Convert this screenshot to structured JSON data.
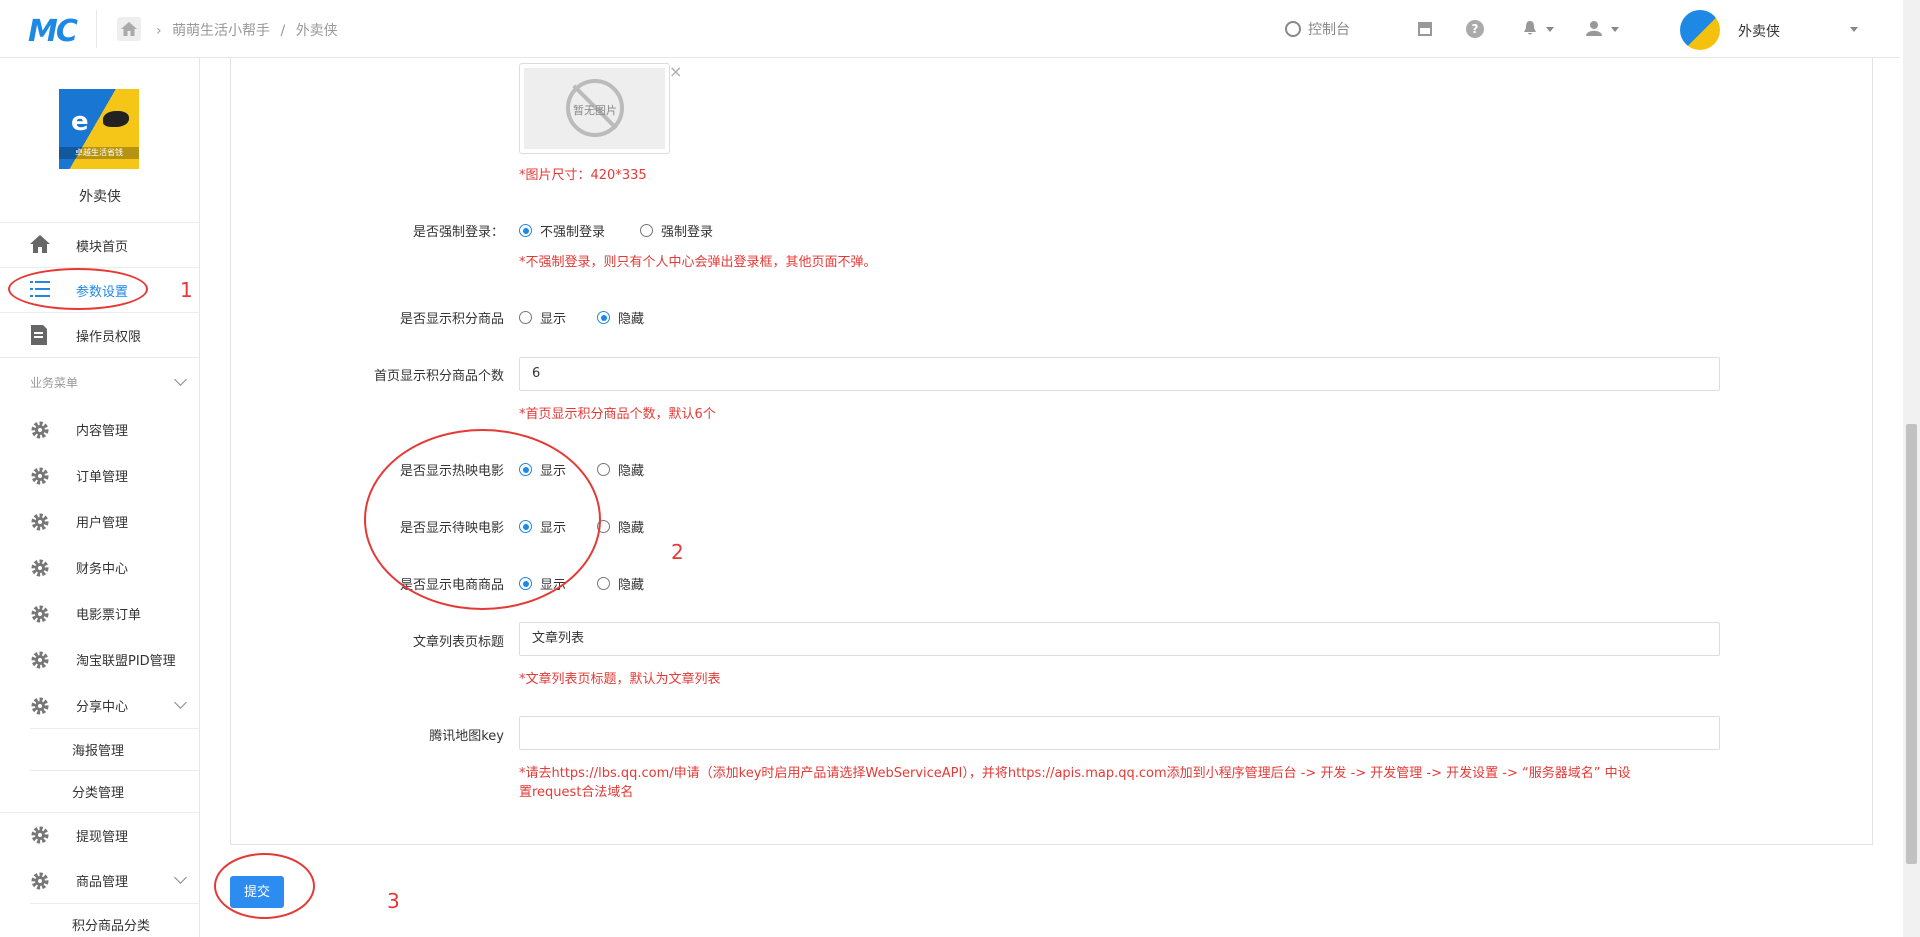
{
  "header": {
    "logo_text": "MC",
    "breadcrumb": [
      "萌萌生活小帮手",
      "外卖侠"
    ],
    "console_label": "控制台",
    "user_name": "外卖侠"
  },
  "sidebar": {
    "shop_name": "外卖侠",
    "shop_logo_caption": "卓越生活省钱",
    "top_items": [
      {
        "label": "模块首页",
        "icon": "home-icon"
      },
      {
        "label": "参数设置",
        "icon": "list-icon",
        "active": true
      },
      {
        "label": "操作员权限",
        "icon": "document-icon"
      }
    ],
    "section_title": "业务菜单",
    "items": [
      {
        "label": "内容管理",
        "icon": "gear-icon"
      },
      {
        "label": "订单管理",
        "icon": "gear-icon"
      },
      {
        "label": "用户管理",
        "icon": "gear-icon"
      },
      {
        "label": "财务中心",
        "icon": "gear-icon"
      },
      {
        "label": "电影票订单",
        "icon": "gear-icon"
      },
      {
        "label": "淘宝联盟PID管理",
        "icon": "gear-icon"
      },
      {
        "label": "分享中心",
        "icon": "gear-icon",
        "expanded": true
      },
      {
        "label": "提现管理",
        "icon": "gear-icon"
      },
      {
        "label": "商品管理",
        "icon": "gear-icon",
        "expanded": true
      }
    ],
    "share_sub": [
      "海报管理",
      "分类管理"
    ],
    "goods_sub": [
      "积分商品分类"
    ]
  },
  "form": {
    "image_placeholder": "暂无图片",
    "image_close": "×",
    "image_hint": "*图片尺寸：420*335",
    "force_login": {
      "label": "是否强制登录：",
      "options": [
        "不强制登录",
        "强制登录"
      ],
      "selected": 0,
      "hint": "*不强制登录，则只有个人中心会弹出登录框，其他页面不弹。"
    },
    "show_points_goods": {
      "label": "是否显示积分商品",
      "options": [
        "显示",
        "隐藏"
      ],
      "selected": 1
    },
    "points_count": {
      "label": "首页显示积分商品个数",
      "value": "6",
      "hint": "*首页显示积分商品个数，默认6个"
    },
    "show_hot_movies": {
      "label": "是否显示热映电影",
      "options": [
        "显示",
        "隐藏"
      ],
      "selected": 0
    },
    "show_upcoming_movies": {
      "label": "是否显示待映电影",
      "options": [
        "显示",
        "隐藏"
      ],
      "selected": 0
    },
    "show_ecommerce": {
      "label": "是否显示电商商品",
      "options": [
        "显示",
        "隐藏"
      ],
      "selected": 0
    },
    "article_title": {
      "label": "文章列表页标题",
      "value": "文章列表",
      "hint": "*文章列表页标题，默认为文章列表"
    },
    "map_key": {
      "label": "腾讯地图key",
      "value": "",
      "hint_line1": "*请去https://lbs.qq.com/申请（添加key时启用产品请选择WebServiceAPI），并将https://apis.map.qq.com添加到小程序管理后台 -> 开发 -> 开发管理 -> 开发设置 -> “服务器域名” 中设",
      "hint_line2": "置request合法域名"
    },
    "submit_label": "提交"
  },
  "annotations": [
    "1",
    "2",
    "3"
  ],
  "colors": {
    "accent": "#2d8cf0",
    "hint": "#e53935",
    "annotation": "#e53935"
  }
}
